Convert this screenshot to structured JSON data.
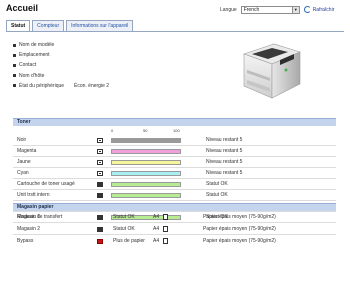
{
  "header": {
    "title": "Accueil",
    "language_label": "Langue",
    "language_value": "French",
    "refresh_label": "Rafraîchir"
  },
  "tabs": [
    {
      "label": "Statut",
      "active": true
    },
    {
      "label": "Compteur",
      "active": false
    },
    {
      "label": "Informations sur l'appareil",
      "active": false
    }
  ],
  "device_info": [
    {
      "label": "Nom de modèle",
      "value": ""
    },
    {
      "label": "Emplacement",
      "value": ""
    },
    {
      "label": "Contact",
      "value": ""
    },
    {
      "label": "Nom d'hôte",
      "value": ""
    },
    {
      "label": "État du périphérique",
      "value": "Écon. énergie 2"
    }
  ],
  "toner": {
    "title": "Toner",
    "scale": [
      "0",
      "50",
      "100"
    ],
    "rows": [
      {
        "label": "Noir",
        "icon": "toner-icon",
        "color": "#9a9a9a",
        "level": 1.0,
        "status": "Niveau restant 5"
      },
      {
        "label": "Magenta",
        "icon": "toner-icon",
        "color": "#f0a0dc",
        "level": 1.0,
        "status": "Niveau restant 5"
      },
      {
        "label": "Jaune",
        "icon": "toner-icon",
        "color": "#f5f59a",
        "level": 1.0,
        "status": "Niveau restant 5"
      },
      {
        "label": "Cyan",
        "icon": "toner-icon",
        "color": "#a8eef2",
        "level": 1.0,
        "status": "Niveau restant 5"
      },
      {
        "label": "Cartouche de toner usagé",
        "icon": "waste-toner-icon",
        "color": "#b7ec94",
        "level": 1.0,
        "status": "Statut OK"
      },
      {
        "label": "Unit trstt intern",
        "icon": "transfer-unit-icon",
        "color": "#b7ec94",
        "level": 1.0,
        "status": "Statut OK"
      },
      {
        "label": "Unité de fusion",
        "icon": "fuser-unit-icon",
        "color": "#b7ec94",
        "level": 1.0,
        "status": "Statut OK"
      },
      {
        "label": "Rouleau de transfert",
        "icon": "transfer-roller-icon",
        "color": "#b7ec94",
        "level": 1.0,
        "status": "Statut OK"
      }
    ]
  },
  "paper": {
    "title": "Magasin papier",
    "rows": [
      {
        "label": "Magasin 1",
        "icon": "tray-icon",
        "alert": false,
        "status": "Statut OK",
        "size": "A4",
        "type": "Papier épais moyen (75-90g/m2)"
      },
      {
        "label": "Magasin 2",
        "icon": "tray-icon",
        "alert": false,
        "status": "Statut OK",
        "size": "A4",
        "type": "Papier épais moyen (75-90g/m2)"
      },
      {
        "label": "Bypass",
        "icon": "tray-empty-icon",
        "alert": true,
        "status": "Plus de papier",
        "size": "A4",
        "type": "Papier épais moyen (75-90g/m2)"
      }
    ]
  }
}
